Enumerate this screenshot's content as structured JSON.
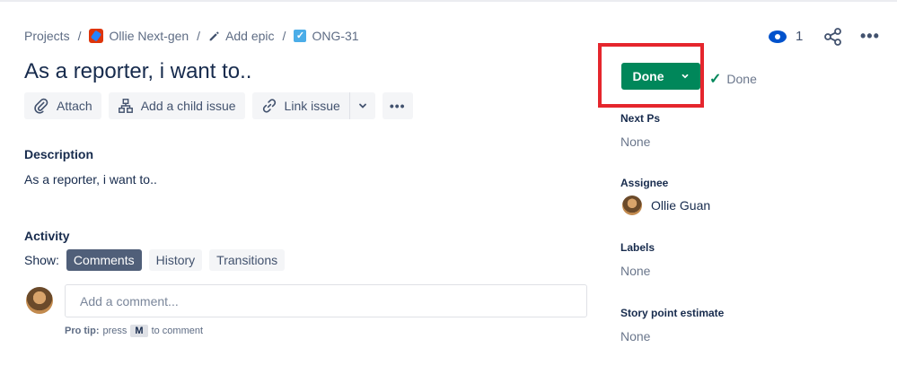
{
  "breadcrumb": {
    "projects": "Projects",
    "project_name": "Ollie Next-gen",
    "epic": "Add epic",
    "issue_key": "ONG-31",
    "separator": "/"
  },
  "issue": {
    "title": "As a reporter, i want to.."
  },
  "actions": {
    "attach": "Attach",
    "add_child": "Add a child issue",
    "link_issue": "Link issue",
    "more": "•••"
  },
  "description": {
    "label": "Description",
    "text": "As a reporter, i want to.."
  },
  "activity": {
    "label": "Activity",
    "show_label": "Show:",
    "tabs": [
      "Comments",
      "History",
      "Transitions"
    ],
    "active_tab": "Comments",
    "comment_placeholder": "Add a comment...",
    "protip_label": "Pro tip:",
    "protip_text_pre": "press",
    "protip_key": "M",
    "protip_text_post": "to comment"
  },
  "header_right": {
    "watchers_count": "1",
    "more": "•••"
  },
  "status": {
    "button_label": "Done",
    "resolution_label": "Done",
    "highlight_color": "#e5262d",
    "button_color": "#00875a"
  },
  "fields": {
    "next_ps_label": "Next Ps",
    "next_ps_value": "None",
    "assignee_label": "Assignee",
    "assignee_name": "Ollie Guan",
    "labels_label": "Labels",
    "labels_value": "None",
    "story_point_label": "Story point estimate",
    "story_point_value": "None"
  },
  "icons": [
    "project-icon",
    "pencil-icon",
    "story-check-icon",
    "paperclip-icon",
    "child-issue-icon",
    "link-icon",
    "chevron-down-icon",
    "eye-icon",
    "share-icon",
    "more-icon",
    "checkmark-icon"
  ]
}
